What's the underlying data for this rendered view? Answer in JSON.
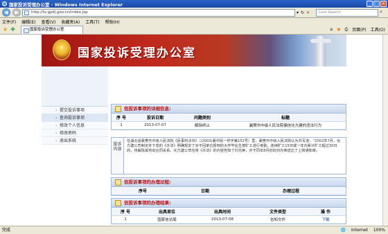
{
  "window": {
    "title": "国家投诉受理办公室 - Windows Internet Explorer"
  },
  "address": {
    "url": "http://ts.gjxfj.gov.cn/index.jsp",
    "search_placeholder": "Live Search"
  },
  "menu": [
    "文件(F)",
    "编辑(E)",
    "查看(V)",
    "收藏夹(A)",
    "工具(T)",
    "帮助(H)"
  ],
  "tab": {
    "label": "国家投诉受理办公室"
  },
  "commands": {
    "page": "页面(P)",
    "tools": "工具(O)"
  },
  "banner": {
    "title": "国家投诉受理办公室"
  },
  "sidebar": {
    "items": [
      {
        "label": "提交投诉事项"
      },
      {
        "label": "查询投诉事项"
      },
      {
        "label": "修改个人信息"
      },
      {
        "label": "修改密码"
      },
      {
        "label": "退出系统"
      }
    ]
  },
  "detail": {
    "heading": "信投诉事项的详细信息:",
    "columns": [
      "序 号",
      "投诉日期",
      "问题类别",
      "标题"
    ],
    "rows": [
      {
        "no": "1",
        "date": "2013-07-07",
        "category": "解除终止",
        "title": "襄樊市中级人民法院偏信化亢建的违法行为"
      }
    ]
  },
  "content_box": {
    "label": "投诉内容",
    "text": "在湖北省襄樊市中级人民法院《民事判决书》（(2003)襄中民一终字第152号）里，襄樊市中级人民法院认为并写道：“2002年7月，化亢建公司制定并下发的《办法》明确规定了对不回单位报到的大学毕业生按旷工进行考勤，连续旷工15日或一年内累计旷工超过30日的，将解除其劳动合同关系。化亢建公司也将《办法》的内容告知了刘光荣，并于同年8月初向刘光荣送达了上岗通知单。"
  },
  "process": {
    "heading": "信投诉事项的办理过程:",
    "columns": [
      "序号",
      "日期",
      "办理过程"
    ]
  },
  "result": {
    "heading": "信投诉事项的办理结果:",
    "columns": [
      "序 号",
      "出具单位",
      "出具时间",
      "文件类型",
      "操 作"
    ],
    "rows": [
      {
        "no": "1",
        "unit": "国家信访局",
        "time": "2013-07-08",
        "type": "告知文件",
        "action": "下载"
      }
    ]
  },
  "status": {
    "left": "完成",
    "zone": "Internet",
    "zoom": "100%"
  }
}
